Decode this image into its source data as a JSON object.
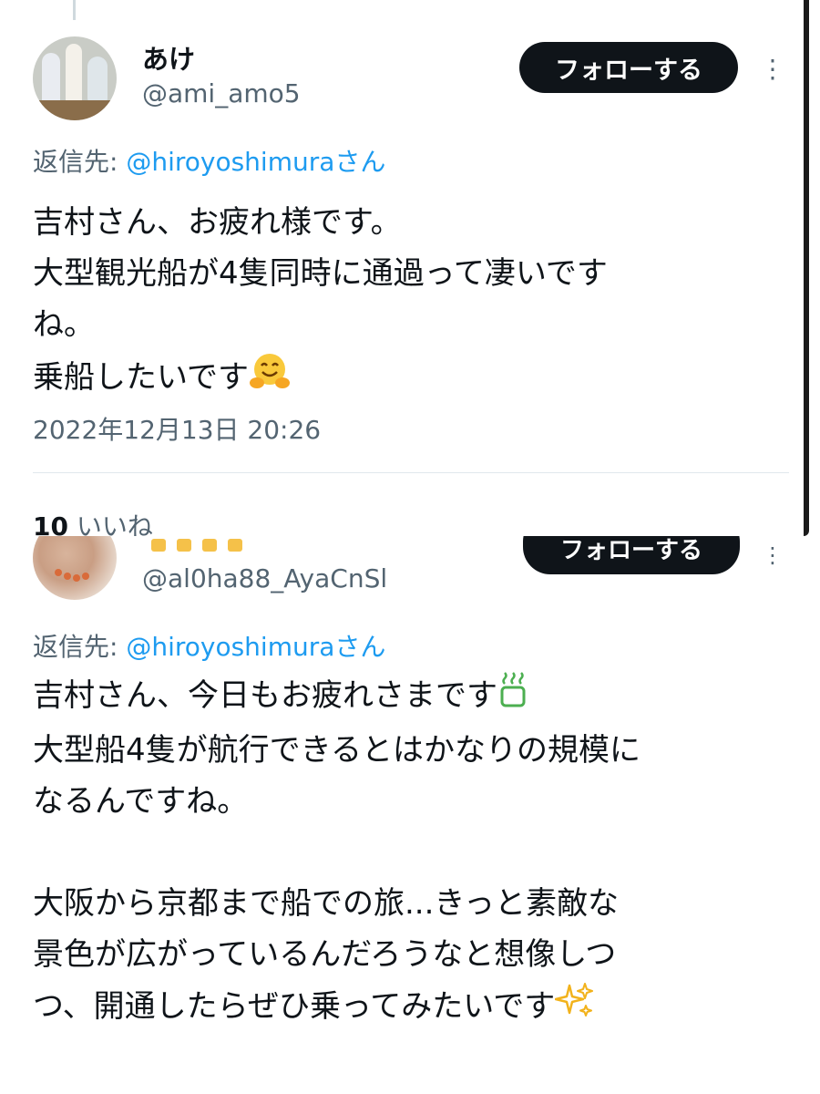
{
  "tweet1": {
    "display_name": "あけ",
    "handle": "@ami_amo5",
    "follow_label": "フォローする",
    "reply_prefix": "返信先: ",
    "reply_handle": "@hiroyoshimuraさん",
    "body_text": "吉村さん、お疲れ様です。\n大型観光船が4隻同時に通過って凄いです\nね。\n乗船したいです",
    "timestamp": "2022年12月13日 20:26",
    "like_count": "10",
    "like_label": " いいね"
  },
  "tweet2": {
    "handle": "@al0ha88_AyaCnSl",
    "follow_label": "フォローする",
    "reply_prefix": "返信先: ",
    "reply_handle": "@hiroyoshimuraさん",
    "body_line1": "吉村さん、今日もお疲れさまです",
    "body_rest": "\n大型船4隻が航行できるとはかなりの規模に\nなるんですね。\n\n大阪から京都まで船での旅...きっと素敵な\n景色が広がっているんだろうなと想像しつ\nつ、開通したらぜひ乗ってみたいです"
  },
  "icons": {
    "more": "more-options-icon",
    "emoji1": "hugging-face-emoji",
    "emoji2": "hot-beverage-emoji",
    "emoji3": "sparkles-emoji"
  },
  "colors": {
    "link": "#1d9bf0",
    "muted": "#536471",
    "button": "#0f1419"
  }
}
